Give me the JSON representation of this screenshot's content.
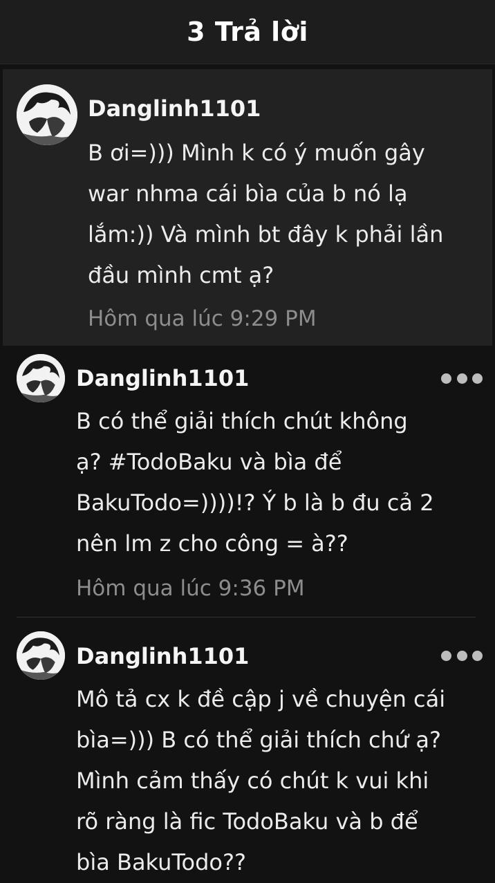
{
  "header": {
    "title": "3 Trả lời"
  },
  "parent_comment": {
    "author": "Danglinh1101",
    "lines": [
      "B ơi=))) Mình k có ý muốn gây",
      "war nhma cái bìa của b nó lạ",
      "lắm:)) Và mình bt đây k phải lần",
      "đầu mình cmt ạ?"
    ],
    "timestamp": "Hôm qua lúc 9:29 PM",
    "avatar_icon": "anime-avatar-icon"
  },
  "replies": [
    {
      "author": "Danglinh1101",
      "lines": [
        "B có thể giải thích chút không",
        "ạ? #TodoBaku và bìa để",
        "BakuTodo=))))!? Ý b là b đu cả 2",
        "nên lm z cho công = à??"
      ],
      "timestamp": "Hôm qua lúc 9:36 PM",
      "more_icon": "more-dots-icon"
    },
    {
      "author": "Danglinh1101",
      "lines": [
        "Mô tả cx k đề cập j về chuyện cái",
        "bìa=))) B có thể giải thích chứ ạ?",
        "Mình cảm thấy có chút k vui khi",
        "rõ ràng là fic TodoBaku và b để",
        "bìa BakuTodo??"
      ],
      "more_icon": "more-dots-icon"
    }
  ],
  "colors": {
    "background": "#121212",
    "header_bg": "#1d1d1d",
    "parent_bg": "#222222",
    "timestamp": "#8d8d8d"
  }
}
